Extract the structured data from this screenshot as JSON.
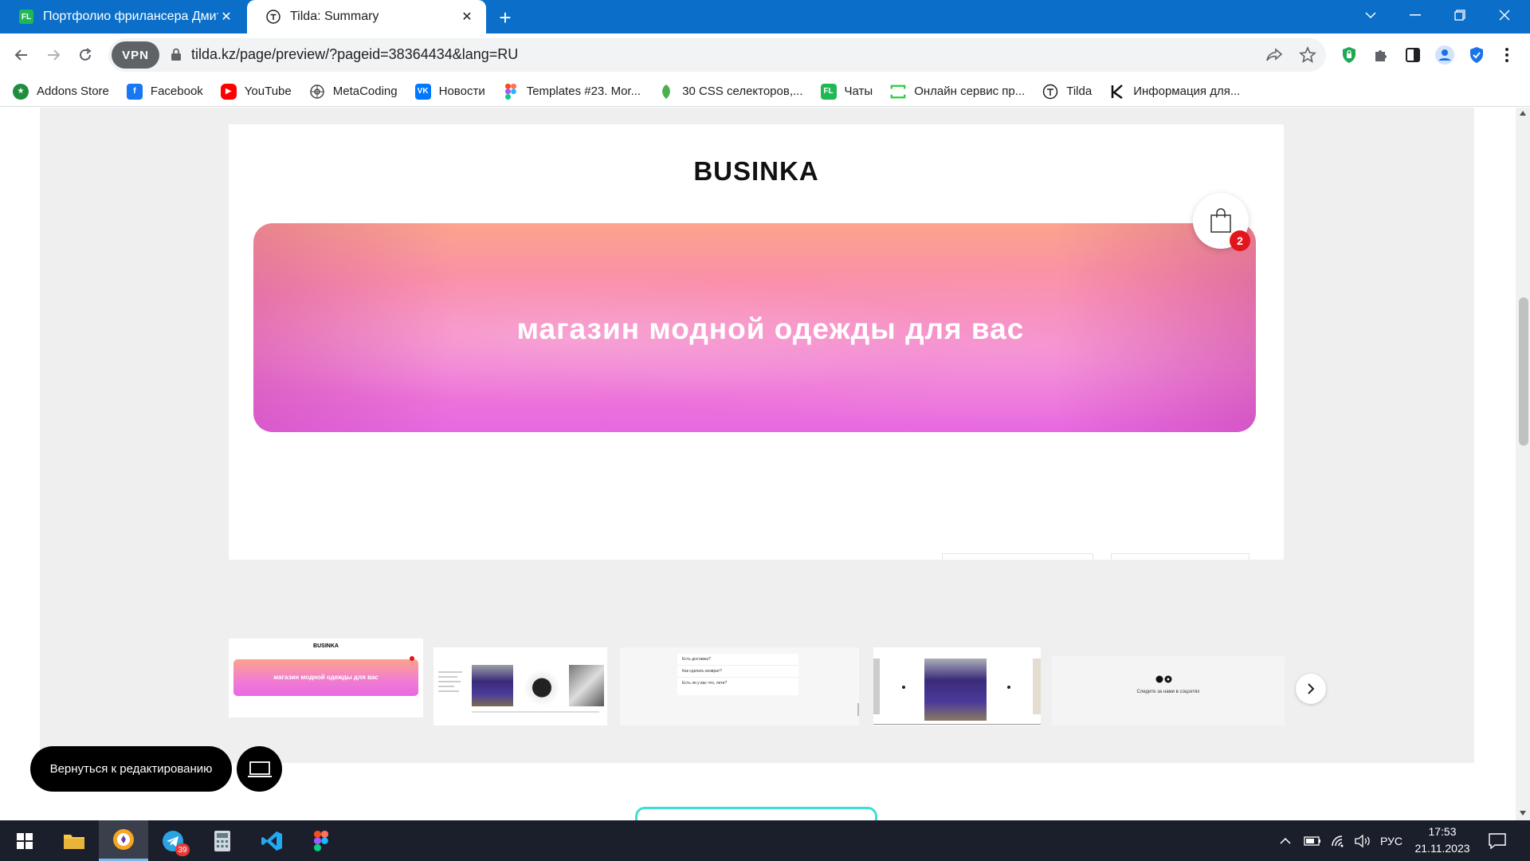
{
  "browser": {
    "tabs": [
      {
        "label": "Портфолио фрилансера Дмитр",
        "favicon": "FL",
        "active": false
      },
      {
        "label": "Tilda: Summary",
        "favicon": "T",
        "active": true
      }
    ],
    "url": "tilda.kz/page/preview/?pageid=38364434&lang=RU",
    "vpn_label": "VPN"
  },
  "bookmarks": [
    {
      "label": "Addons Store",
      "icon": "addons-store-icon",
      "color": "#1e8e3e"
    },
    {
      "label": "Facebook",
      "icon": "facebook-icon",
      "color": "#1877f2"
    },
    {
      "label": "YouTube",
      "icon": "youtube-icon",
      "color": "#ff0000"
    },
    {
      "label": "MetaCoding",
      "icon": "metacoding-icon",
      "color": "#444444"
    },
    {
      "label": "Новости",
      "icon": "vk-icon",
      "color": "#0077ff"
    },
    {
      "label": "Templates #23. Mor...",
      "icon": "figma-icon",
      "color": "#f24e1e"
    },
    {
      "label": "30 CSS селекторов,...",
      "icon": "leaf-icon",
      "color": "#4caf50"
    },
    {
      "label": "Чаты",
      "icon": "fl-icon",
      "color": "#1fb954"
    },
    {
      "label": "Онлайн сервис пр...",
      "icon": "frame-icon",
      "color": "#2ecc40"
    },
    {
      "label": "Tilda",
      "icon": "tilda-icon",
      "color": "#222222"
    },
    {
      "label": "Информация для...",
      "icon": "k-icon",
      "color": "#111111"
    }
  ],
  "preview": {
    "brand": "BUSINKA",
    "banner_text": "магазин модной одежды для вас",
    "cart_count": "2"
  },
  "thumbnails": {
    "t1_brand": "BUSINKA",
    "t1_text": "магазин модной одежды для вас",
    "t3_items": [
      "Есть доставка?",
      "Как сделать возврат?",
      "Есть ли у вас что, лети?"
    ],
    "t5_text": "Следите за нами в соцсетях"
  },
  "actions": {
    "back_to_edit": "Вернуться к редактированию"
  },
  "taskbar": {
    "telegram_badge": "39",
    "lang": "РУС",
    "time": "17:53",
    "date": "21.11.2023"
  }
}
